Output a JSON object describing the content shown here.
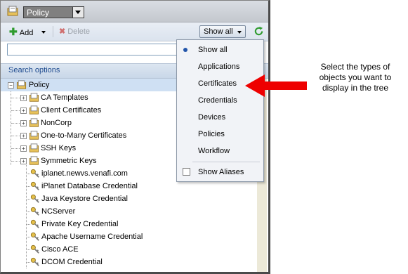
{
  "header": {
    "selector_value": "Policy"
  },
  "toolbar": {
    "add_label": "Add",
    "delete_label": "Delete",
    "view_label": "Show all"
  },
  "search": {
    "value": "",
    "options_label": "Search options"
  },
  "tree": {
    "root": "Policy",
    "folders": [
      "CA Templates",
      "Client Certificates",
      "NonCorp",
      "One-to-Many Certificates",
      "SSH Keys",
      "Symmetric Keys"
    ],
    "credentials": [
      "iplanet.newvs.venafi.com",
      "iPlanet Database Credential",
      "Java Keystore Credential",
      "NCServer",
      "Private Key Credential",
      "Apache Username Credential",
      "Cisco ACE",
      "DCOM Credential"
    ]
  },
  "menu": {
    "items": [
      "Show all",
      "Applications",
      "Certificates",
      "Credentials",
      "Devices",
      "Policies",
      "Workflow"
    ],
    "selected": "Show all",
    "checkbox_label": "Show Aliases",
    "checkbox_checked": false
  },
  "callout": {
    "line1": "Select the types of",
    "line2": "objects you want to",
    "line3": "display in the tree"
  },
  "colors": {
    "accent": "#2255aa",
    "arrow": "#ee0000",
    "selection": "#cfe0f3"
  }
}
